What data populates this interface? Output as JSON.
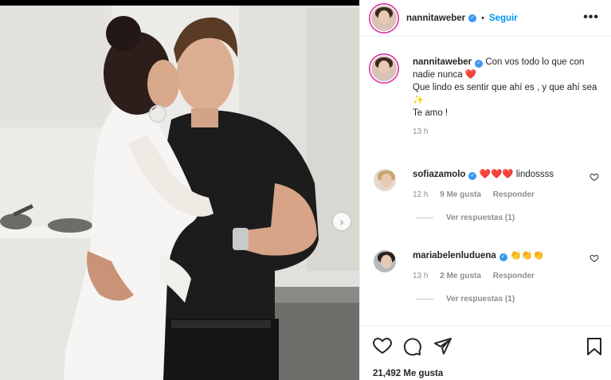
{
  "post": {
    "username": "nannitaweber",
    "follow_label": "Seguir",
    "dot": "•",
    "more_label": "•••",
    "next_label": "›"
  },
  "caption": {
    "username": "nannitaweber",
    "line1": "Con vos todo lo que con nadie nunca",
    "heart": "❤️",
    "line2": "Que lindo es sentir que ahí es , y que ahí sea",
    "sparkle": "✨",
    "line3": "Te amo !",
    "time": "13 h"
  },
  "comments": [
    {
      "username": "sofiazamolo",
      "emoji": "❤️❤️❤️",
      "text": "lindossss",
      "time": "12 h",
      "likes": "9 Me gusta",
      "reply": "Responder",
      "view_replies": "Ver respuestas (1)"
    },
    {
      "username": "mariabelenluduena",
      "emoji": "👏👏👏",
      "text": "",
      "time": "13 h",
      "likes": "2 Me gusta",
      "reply": "Responder",
      "view_replies": "Ver respuestas (1)"
    }
  ],
  "footer": {
    "likes": "21,492 Me gusta"
  },
  "icons": {
    "like": "heart-icon",
    "comment": "comment-icon",
    "share": "share-icon",
    "save": "bookmark-icon"
  },
  "colors": {
    "link": "#0095f6",
    "verified": "#3897f0",
    "muted": "#8e8e8e"
  }
}
